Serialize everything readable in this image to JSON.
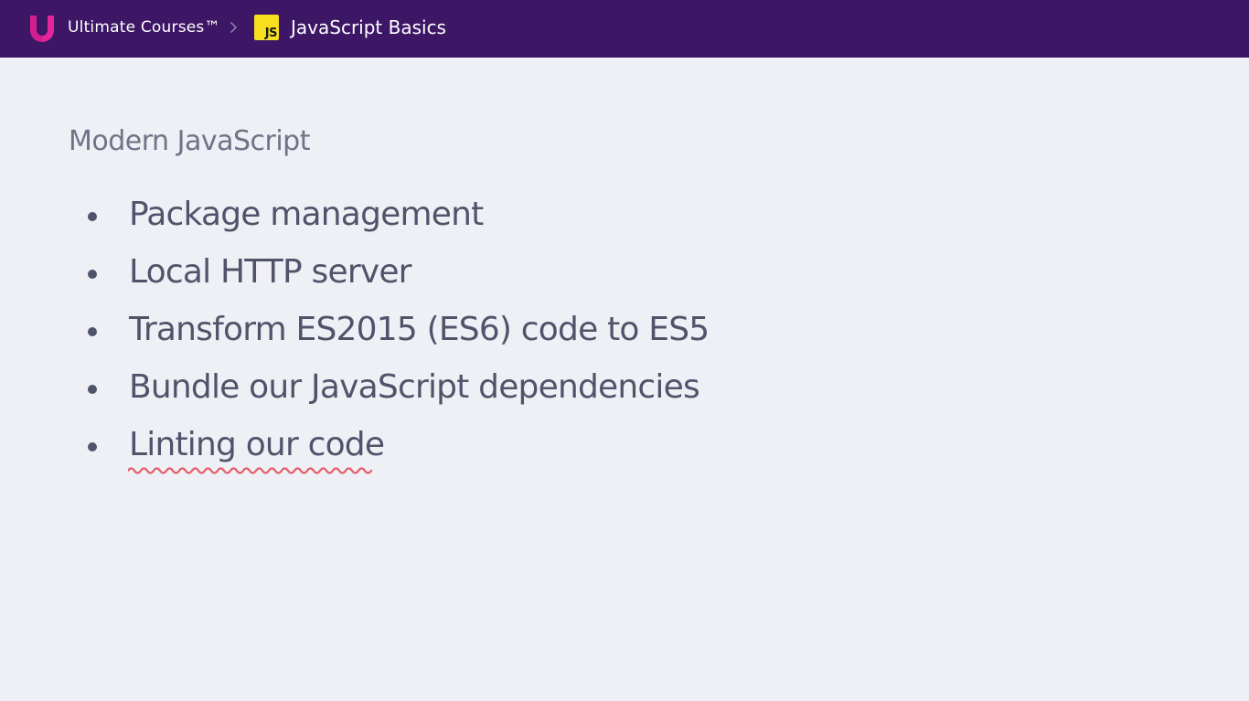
{
  "header": {
    "brand": "Ultimate Courses™",
    "course_badge": "JS",
    "course_title": "JavaScript Basics",
    "brand_color": "#3d1766",
    "logo_color": "#e6249b",
    "badge_color": "#f7df1e"
  },
  "slide": {
    "title": "Modern JavaScript",
    "bullets": [
      "Package management",
      "Local HTTP server",
      "Transform ES2015 (ES6) code to ES5",
      "Bundle our JavaScript dependencies",
      "Linting our code"
    ],
    "spellcheck_color": "#e25d68"
  }
}
